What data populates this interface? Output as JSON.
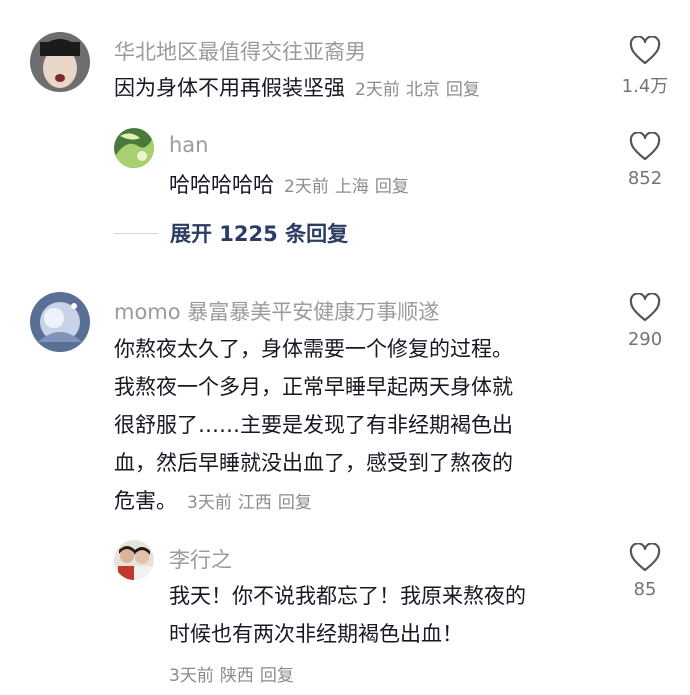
{
  "comments": [
    {
      "username": "华北地区最值得交往亚裔男",
      "text_lines": [
        "因为身体不用再假装坚强"
      ],
      "time": "2天前",
      "location": "北京",
      "reply_label": "回复",
      "likes": "1.4万"
    },
    {
      "username": "han",
      "text_lines": [
        "哈哈哈哈哈"
      ],
      "time": "2天前",
      "location": "上海",
      "reply_label": "回复",
      "likes": "852"
    },
    {
      "username": "momo 暴富暴美平安健康万事顺遂",
      "text_lines": [
        "你熬夜太久了，身体需要一个修复的过程。",
        "我熬夜一个多月，正常早睡早起两天身体就",
        "很舒服了……主要是发现了有非经期褐色出",
        "血，然后早睡就没出血了，感受到了熬夜的",
        "危害。"
      ],
      "time": "3天前",
      "location": "江西",
      "reply_label": "回复",
      "likes": "290"
    },
    {
      "username": "李行之",
      "text_lines": [
        "我天！你不说我都忘了！我原来熬夜的",
        "时候也有两次非经期褐色出血！"
      ],
      "time": "3天前",
      "location": "陕西",
      "reply_label": "回复",
      "likes": "85"
    }
  ],
  "expand_replies": "展开 1225 条回复",
  "icons": {
    "like": "heart-outline-icon"
  },
  "colors": {
    "name": "#9a9ba0",
    "text": "#161823",
    "meta": "#8a8b91",
    "expand": "#2a3b66"
  }
}
